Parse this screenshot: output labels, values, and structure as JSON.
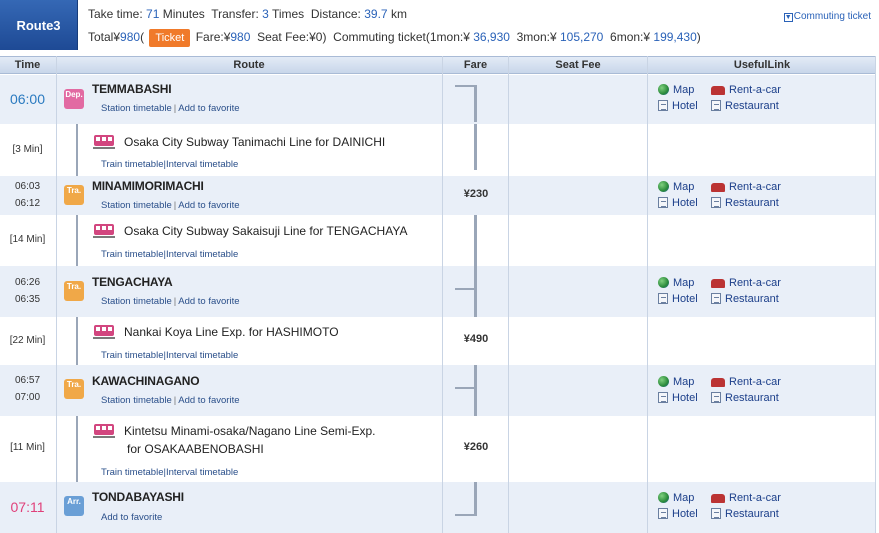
{
  "route_label": "Route3",
  "summary": {
    "take_time_label": "Take time:",
    "take_time_value": "71",
    "take_time_unit": "Minutes",
    "transfer_label": "Transfer:",
    "transfer_value": "3",
    "transfer_unit": "Times",
    "distance_label": "Distance:",
    "distance_value": "39.7",
    "distance_unit": "km",
    "total_label": "Total¥",
    "total_value": "980",
    "total_paren": "(",
    "ticket_button": "Ticket",
    "fare_label": "Fare:¥",
    "fare_value": "980",
    "seat_fee_label": "Seat Fee:¥",
    "seat_fee_value": "0",
    "seat_fee_close": ")",
    "commuting_label": "Commuting ticket(1mon:¥",
    "mon1_value": "36,930",
    "mon3_label": "3mon:¥",
    "mon3_value": "105,270",
    "mon6_label": "6mon:¥",
    "mon6_value": "199,430",
    "commuting_close": ")"
  },
  "commuting_ticket_link": "Commuting ticket",
  "columns": {
    "time": "Time",
    "route": "Route",
    "fare": "Fare",
    "seat_fee": "Seat Fee",
    "useful_link": "UsefulLink"
  },
  "useful_links": {
    "map": "Map",
    "rent": "Rent-a-car",
    "hotel": "Hotel",
    "restaurant": "Restaurant"
  },
  "station_links": {
    "timetable": "Station timetable",
    "favorite": "Add to favorite"
  },
  "leg_links": {
    "train_timetable": "Train timetable",
    "interval_timetable": "Interval timetable"
  },
  "stations": [
    {
      "name": "TEMMABASHI",
      "time": "06:00",
      "badge": "Dep."
    },
    {
      "name": "MINAMIMORIMACHI",
      "arr": "06:03",
      "dep": "06:12",
      "badge": "Tra."
    },
    {
      "name": "TENGACHAYA",
      "arr": "06:26",
      "dep": "06:35",
      "badge": "Tra."
    },
    {
      "name": "KAWACHINAGANO",
      "arr": "06:57",
      "dep": "07:00",
      "badge": "Tra."
    },
    {
      "name": "TONDABAYASHI",
      "time": "07:11",
      "badge": "Arr."
    }
  ],
  "legs": [
    {
      "minutes": "[3 Min]",
      "line": "Osaka City Subway Tanimachi Line  for DAINICHI",
      "fare": ""
    },
    {
      "minutes": "[14 Min]",
      "line": "Osaka City Subway Sakaisuji Line  for TENGACHAYA",
      "fare": ""
    },
    {
      "minutes": "[22 Min]",
      "line": "Nankai Koya Line Exp.  for HASHIMOTO",
      "fare": ""
    },
    {
      "minutes": "[11 Min]",
      "line": "Kintetsu Minami-osaka/Nagano Line Semi-Exp.",
      "line2": "for OSAKAABENOBASHI",
      "fare": ""
    }
  ],
  "fares": [
    "¥230",
    "¥490",
    "¥260"
  ],
  "colors": {
    "header_blue": "#1e4a95",
    "ticket_orange": "#f07a2a",
    "link_blue": "#2a62b8",
    "dep_pink": "#e26aa2",
    "transfer_orange": "#f0a848",
    "arr_blue": "#6a9fd6"
  }
}
